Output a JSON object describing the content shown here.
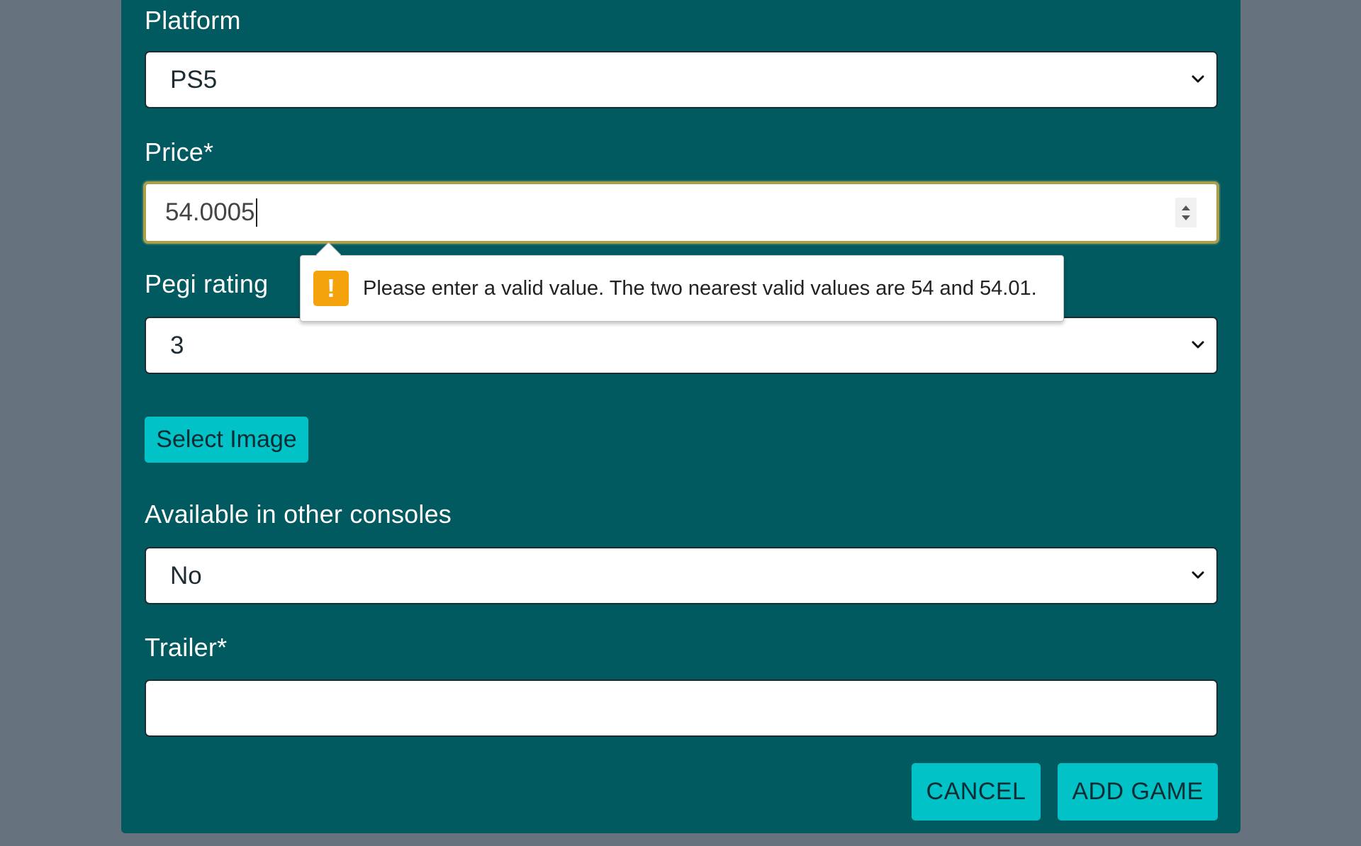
{
  "form": {
    "platform": {
      "label": "Platform",
      "value": "PS5"
    },
    "price": {
      "label": "Price*",
      "value": "54.0005"
    },
    "validation_tooltip": {
      "message": "Please enter a valid value. The two nearest valid values are 54 and 54.01."
    },
    "pegi": {
      "label": "Pegi rating",
      "value": "3"
    },
    "select_image": {
      "label": "Select Image"
    },
    "other_consoles": {
      "label": "Available in other consoles",
      "value": "No"
    },
    "trailer": {
      "label": "Trailer*",
      "value": ""
    }
  },
  "actions": {
    "cancel_label": "CANCEL",
    "add_label": "ADD GAME"
  },
  "colors": {
    "background": "#66737f",
    "panel": "#005a5f",
    "button": "#00c2c7",
    "warning": "#f5a30c",
    "focus_border": "#a9a04c"
  },
  "icons": {
    "select_arrow": "chevron-down-icon",
    "warning": "exclamation-icon",
    "spinner": "spinner-arrows-icon"
  }
}
